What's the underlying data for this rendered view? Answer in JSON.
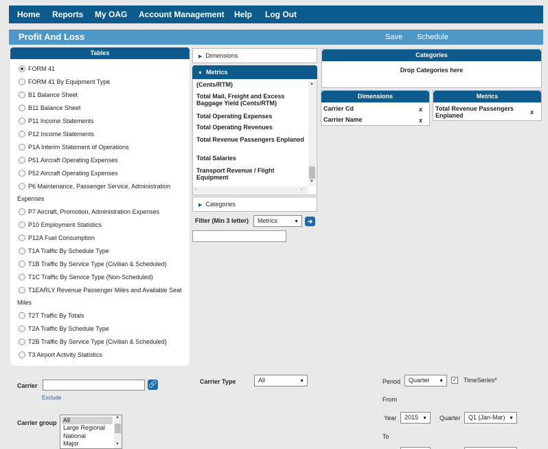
{
  "nav": {
    "items": [
      "Home",
      "Reports",
      "My OAG",
      "Account Management",
      "Help",
      "Log Out"
    ]
  },
  "titlebar": {
    "title": "Profit And Loss",
    "save_label": "Save",
    "schedule_label": "Schedule"
  },
  "tables": {
    "header": "Tables",
    "items": [
      "FORM 41",
      "FORM 41 By Equipment Type",
      "B1 Balance Sheet",
      "B11 Balance Sheet",
      "P11 Income Statements",
      "P12 Income Statements",
      "P1A Interim Statement of Operations",
      "P51 Aircraft Operating Expenses",
      "P52 Aircraft Operating Expenses",
      "P6 Maintenance, Passenger Service, Administration",
      "P7 Aircraft, Promotion, Administration Expenses",
      "P10 Employment Statistics",
      "P12A Fuel Consumption",
      "T1A Traffic By Schedule Type",
      "T1B Traffic By Service Type (Civilian & Scheduled)",
      "T1C Traffic By Service Type (Non-Scheduled)",
      "T1EARLY Revenue Passenger Miles and Available Seat",
      "T2T Traffic By Totals",
      "T2A Traffic By Schedule Type",
      "T2B Traffic By Service Type (Civilian & Scheduled)",
      "T3 Airport Activity Statistics"
    ],
    "continuations": [
      "Expenses",
      "Miles"
    ],
    "selected": "FORM 41"
  },
  "builder": {
    "dimensions_label": "Dimensions",
    "metrics_label": "Metrics",
    "categories_label": "Categories",
    "metrics_items": [
      "(Cents/RTM)",
      "Total Mail, Freight and Excess Baggage Yield (Cents/RTM)",
      "Total Operating Expenses",
      "Total Operating Revenues",
      "Total Revenue Passengers Enplaned",
      "Total Salaries",
      "Transport Revenue / Flight Equipment"
    ],
    "filter_label": "Filter (Min 3 letter)",
    "filter_select_value": "Metrics",
    "filter_input_value": ""
  },
  "right": {
    "categories_header": "Categories",
    "categories_drop": "Drop Categories here",
    "dimensions_header": "Dimensions",
    "dimensions_chips": [
      "Carrier Cd",
      "Carrier Name"
    ],
    "metrics_header": "Metrics",
    "metrics_chips": [
      "Total Revenue Passengers Enplaned"
    ],
    "remove_glyph": "x"
  },
  "form": {
    "carrier_label": "Carrier",
    "carrier_value": "",
    "exclude_label": "Exclude",
    "carrier_group_label": "Carrier group",
    "carrier_group_options": [
      "All",
      "Large Regional",
      "National",
      "Major"
    ],
    "carrier_group_selected": "All",
    "carrier_type_label": "Carrier Type",
    "carrier_type_value": "All",
    "period_label": "Period",
    "period_value": "Quarter",
    "timeseries_label": "TimeSeries*",
    "timeseries_checked": true,
    "from_label": "From",
    "year_label": "Year",
    "year_value": "2015",
    "quarter_label": "Quarter",
    "quarter_value": "Q1 (Jan-Mar)",
    "to_label": "To"
  }
}
